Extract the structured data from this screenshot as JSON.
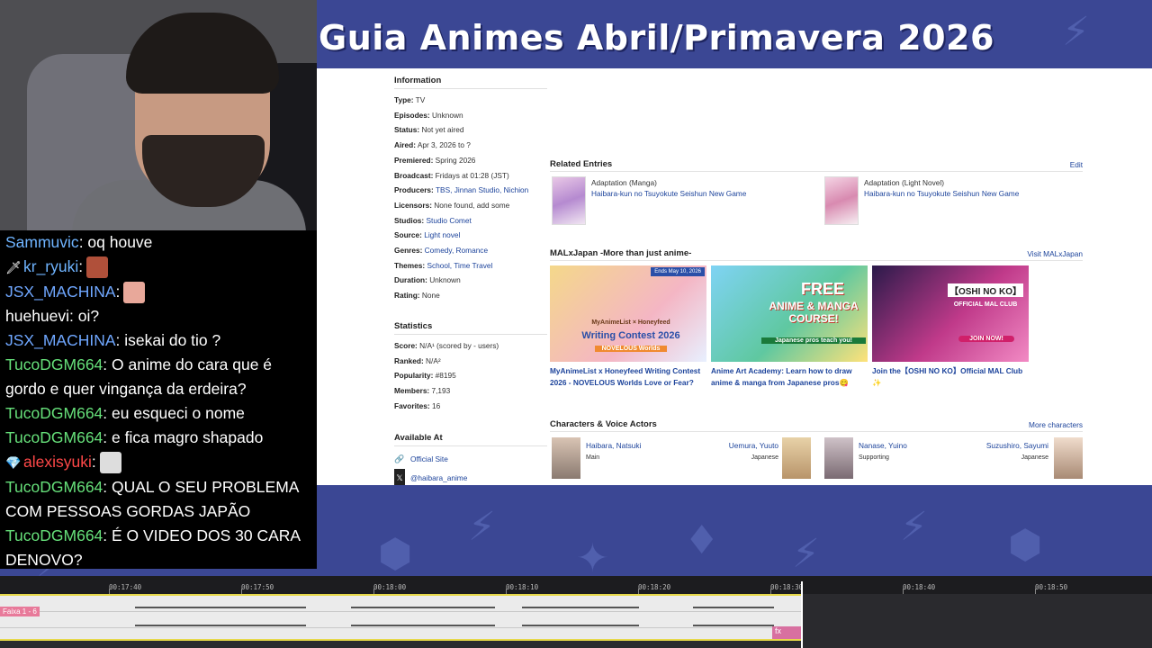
{
  "banner": {
    "title": "Guia Animes Abril/Primavera 2026"
  },
  "chat": {
    "messages": [
      {
        "user": "Sammuvic",
        "color": "#6fb4ff",
        "text": ": oq houve",
        "emote": false,
        "badge": ""
      },
      {
        "user": "kr_ryuki",
        "color": "#6fb4ff",
        "text": ":",
        "emote": true,
        "badge": "sword-icon"
      },
      {
        "user": "JSX_MACHINA",
        "color": "#6fa7ff",
        "text": ":",
        "emote": true,
        "badge": ""
      },
      {
        "user": "huehuevi",
        "color": "#ffffff",
        "text": ": oi?",
        "emote": false,
        "badge": ""
      },
      {
        "user": "JSX_MACHINA",
        "color": "#6fa7ff",
        "text": ": isekai do tio ?",
        "emote": false,
        "badge": ""
      },
      {
        "user": "TucoDGM664",
        "color": "#66e07a",
        "text": ": O anime do cara que é gordo e quer vingança da erdeira?",
        "emote": false,
        "badge": ""
      },
      {
        "user": "TucoDGM664",
        "color": "#66e07a",
        "text": ": eu esqueci o nome",
        "emote": false,
        "badge": ""
      },
      {
        "user": "TucoDGM664",
        "color": "#66e07a",
        "text": ": e fica magro shapado",
        "emote": false,
        "badge": ""
      },
      {
        "user": "alexisyuki",
        "color": "#ff4848",
        "text": ":",
        "emote": true,
        "badge": "heart-icon"
      },
      {
        "user": "TucoDGM664",
        "color": "#66e07a",
        "text": ": QUAL O SEU PROBLEMA COM PESSOAS GORDAS JAPÃO",
        "emote": false,
        "badge": ""
      },
      {
        "user": "TucoDGM664",
        "color": "#66e07a",
        "text": ": É O VIDEO DOS 30 CARA DENOVO?",
        "emote": false,
        "badge": ""
      }
    ]
  },
  "sidebar": {
    "information_heading": "Information",
    "info": [
      {
        "label": "Type:",
        "value": "TV"
      },
      {
        "label": "Episodes:",
        "value": "Unknown"
      },
      {
        "label": "Status:",
        "value": "Not yet aired"
      },
      {
        "label": "Aired:",
        "value": "Apr 3, 2026 to ?"
      },
      {
        "label": "Premiered:",
        "value": "Spring 2026"
      },
      {
        "label": "Broadcast:",
        "value": "Fridays at 01:28 (JST)"
      },
      {
        "label": "Producers:",
        "value": "TBS, Jinnan Studio, Nichion"
      },
      {
        "label": "Licensors:",
        "value": "None found, add some"
      },
      {
        "label": "Studios:",
        "value": "Studio Comet"
      },
      {
        "label": "Source:",
        "value": "Light novel"
      },
      {
        "label": "Genres:",
        "value": "Comedy, Romance"
      },
      {
        "label": "Themes:",
        "value": "School, Time Travel"
      },
      {
        "label": "Duration:",
        "value": "Unknown"
      },
      {
        "label": "Rating:",
        "value": "None"
      }
    ],
    "statistics_heading": "Statistics",
    "stats": [
      {
        "label": "Score:",
        "value": "N/A¹ (scored by - users)"
      },
      {
        "label": "Ranked:",
        "value": "N/A²"
      },
      {
        "label": "Popularity:",
        "value": "#8195"
      },
      {
        "label": "Members:",
        "value": "7,193"
      },
      {
        "label": "Favorites:",
        "value": "16"
      }
    ],
    "available_heading": "Available At",
    "available": [
      {
        "icon": "globe-icon",
        "label": "Official Site"
      },
      {
        "icon": "x-icon",
        "label": "@haibara_anime"
      }
    ]
  },
  "main": {
    "related_heading": "Related Entries",
    "related_edit": "Edit",
    "related": [
      {
        "type": "Adaptation (Manga)",
        "title": "Haibara-kun no Tsuyokute Seishun New Game"
      },
      {
        "type": "Adaptation (Light Novel)",
        "title": "Haibara-kun no Tsuyokute Seishun New Game"
      }
    ],
    "mal_heading": "MALxJapan -More than just anime-",
    "mal_link": "Visit MALxJapan",
    "cards": [
      {
        "caption": "MyAnimeList x Honeyfeed Writing Contest 2026 - NOVELOUS Worlds Love or Fear?",
        "badge": "Ends May 10, 2026",
        "img_text1": "MyAnimeList × Honeyfeed",
        "img_text2": "Writing Contest 2026",
        "img_text3": "NOVELOUS Worlds"
      },
      {
        "caption": "Anime Art Academy: Learn how to draw anime & manga from Japanese pros😋",
        "badge": "",
        "img_text1": "FREE",
        "img_text2": "ANIME & MANGA COURSE!",
        "img_text3": "Japanese pros teach you!"
      },
      {
        "caption": "Join the【OSHI NO KO】Official MAL Club ✨",
        "badge": "",
        "img_text1": "【OSHI NO KO】",
        "img_text2": "OFFICIAL MAL CLUB",
        "img_text3": "JOIN NOW!"
      }
    ],
    "chars_heading": "Characters & Voice Actors",
    "chars_link": "More characters",
    "characters": [
      {
        "name": "Haibara, Natsuki",
        "role": "Main",
        "va": "Uemura, Yuuto",
        "lang": "Japanese"
      },
      {
        "name": "Nanase, Yuino",
        "role": "Supporting",
        "va": "Suzushiro, Sayumi",
        "lang": "Japanese"
      }
    ]
  },
  "timeline": {
    "ticks": [
      "00:17:40",
      "00:17:50",
      "00:18:00",
      "00:18:10",
      "00:18:20",
      "00:18:30",
      "00:18:40",
      "00:18:50"
    ],
    "track_label": "Faixa 1 - 6",
    "fx_label": "fx"
  }
}
